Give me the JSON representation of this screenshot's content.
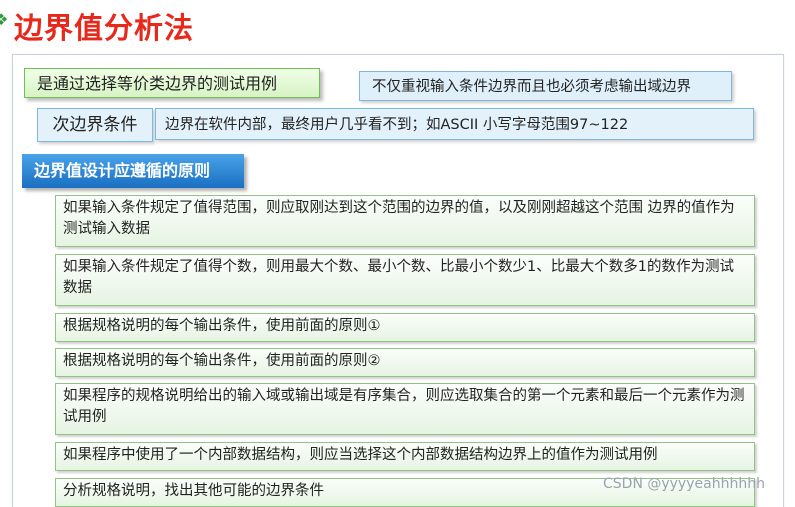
{
  "title": "边界值分析法",
  "definition": "是通过选择等价类边界的测试用例",
  "note": "不仅重视输入条件边界而且也必须考虑输出域边界",
  "sub_boundary": {
    "label": "次边界条件",
    "description": "边界在软件内部，最终用户几乎看不到；如ASCII 小写字母范围97~122"
  },
  "principles_header": "边界值设计应遵循的原则",
  "principles": [
    "如果输入条件规定了值得范围，则应取刚达到这个范围的边界的值，以及刚刚超越这个范围 边界的值作为测试输入数据",
    "如果输入条件规定了值得个数，则用最大个数、最小个数、比最小个数少1、比最大个数多1的数作为测试数据",
    "根据规格说明的每个输出条件，使用前面的原则①",
    "根据规格说明的每个输出条件，使用前面的原则②",
    "如果程序的规格说明给出的输入域或输出域是有序集合，则应选取集合的第一个元素和最后一个元素作为测试用例",
    "如果程序中使用了一个内部数据结构，则应当选择这个内部数据结构边界上的值作为测试用例",
    "分析规格说明，找出其他可能的边界条件"
  ],
  "watermark": "CSDN @yyyyeahhhhhh",
  "colors": {
    "title": "#e8281b",
    "header_bg": "#1a6fc2",
    "rule_border": "#8fc482"
  }
}
